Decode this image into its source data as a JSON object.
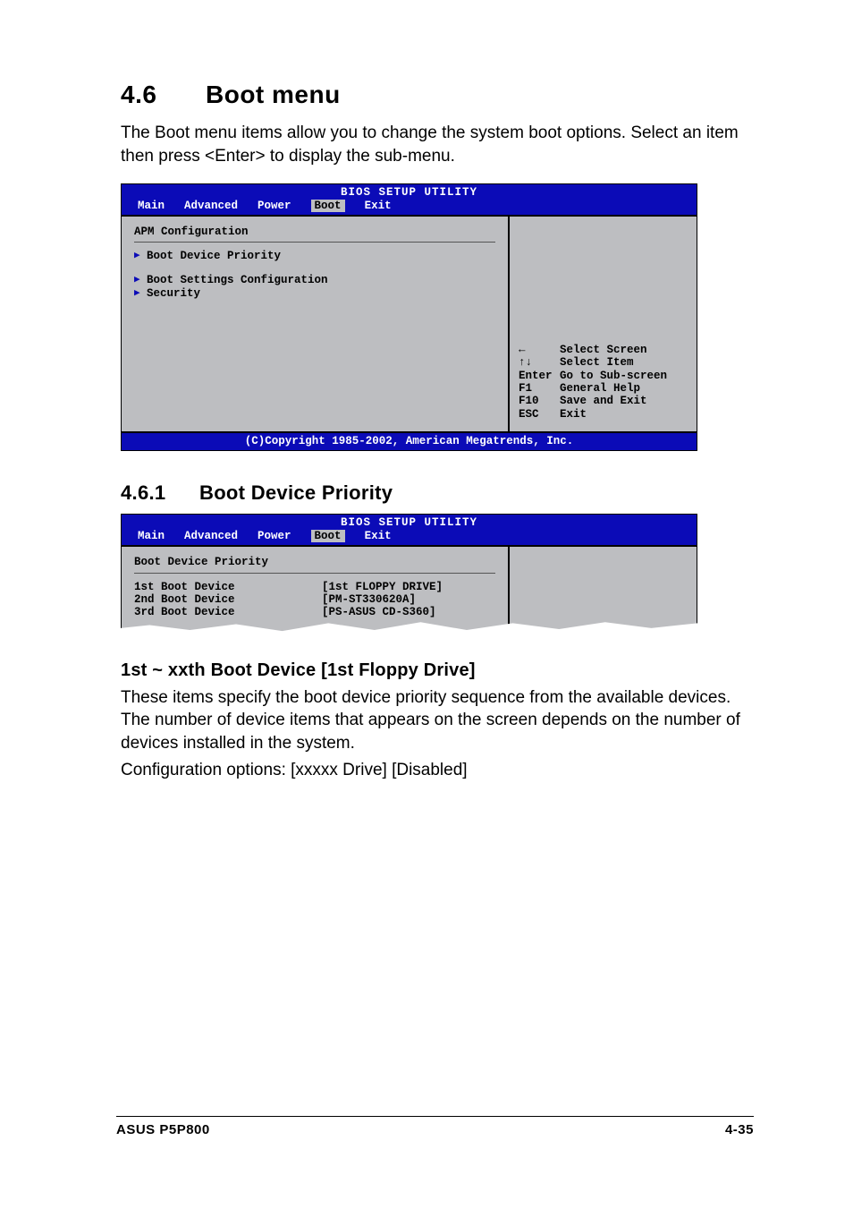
{
  "section": {
    "number": "4.6",
    "title": "Boot menu"
  },
  "intro": "The Boot menu items allow you to change the system boot options. Select an item then press <Enter> to display the sub-menu.",
  "bios1": {
    "title": "BIOS SETUP UTILITY",
    "tabs": [
      "Main",
      "Advanced",
      "Power",
      "Boot",
      "Exit"
    ],
    "activeTab": "Boot",
    "heading": "APM Configuration",
    "items": [
      "Boot Device Priority",
      "Boot Settings Configuration",
      "Security"
    ],
    "help": [
      {
        "key": "←",
        "desc": "Select Screen"
      },
      {
        "key": "↑↓",
        "desc": "Select Item"
      },
      {
        "key": "Enter",
        "desc": "Go to Sub-screen"
      },
      {
        "key": "F1",
        "desc": "General Help"
      },
      {
        "key": "F10",
        "desc": "Save and Exit"
      },
      {
        "key": "ESC",
        "desc": "Exit"
      }
    ],
    "copyright": "(C)Copyright 1985-2002, American Megatrends, Inc."
  },
  "subsection": {
    "number": "4.6.1",
    "title": "Boot Device Priority"
  },
  "bios2": {
    "title": "BIOS SETUP UTILITY",
    "tabs": [
      "Main",
      "Advanced",
      "Power",
      "Boot",
      "Exit"
    ],
    "activeTab": "Boot",
    "heading": "Boot Device Priority",
    "rows": [
      {
        "k": "1st Boot Device",
        "v": "[1st FLOPPY DRIVE]"
      },
      {
        "k": "2nd Boot Device",
        "v": "[PM-ST330620A]"
      },
      {
        "k": "3rd Boot Device",
        "v": "[PS-ASUS CD-S360]"
      }
    ]
  },
  "itemHeading": "1st ~ xxth Boot Device [1st Floppy Drive]",
  "itemBody1": "These items specify the boot device priority sequence from the available devices. The number of device items that appears on the screen depends on the number of devices installed in the system.",
  "itemBody2": "Configuration options: [xxxxx Drive] [Disabled]",
  "footer": {
    "left": "ASUS P5P800",
    "right": "4-35"
  }
}
